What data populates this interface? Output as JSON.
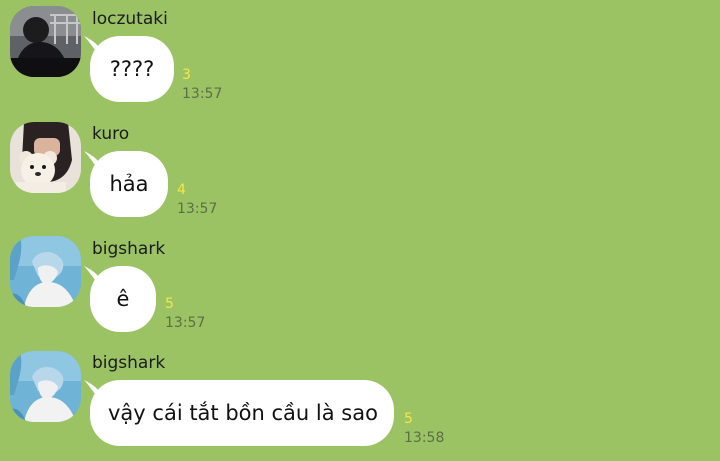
{
  "messages": [
    {
      "sender": "loczutaki",
      "avatar": "dark-silhouette-avatar",
      "text": "????",
      "read_count": "3",
      "time": "13:57"
    },
    {
      "sender": "kuro",
      "avatar": "teddy-bear-person-avatar",
      "text": "hảa",
      "read_count": "4",
      "time": "13:57"
    },
    {
      "sender": "bigshark",
      "avatar": "blue-hair-person-avatar",
      "text": "ê",
      "read_count": "5",
      "time": "13:57"
    },
    {
      "sender": "bigshark",
      "avatar": "blue-hair-person-avatar",
      "text": "vậy cái tắt bồn cầu là sao",
      "read_count": "5",
      "time": "13:58"
    }
  ],
  "colors": {
    "background": "#9bc263",
    "bubble": "#ffffff",
    "read_count": "#f6e84a",
    "time": "#5b6f48"
  }
}
